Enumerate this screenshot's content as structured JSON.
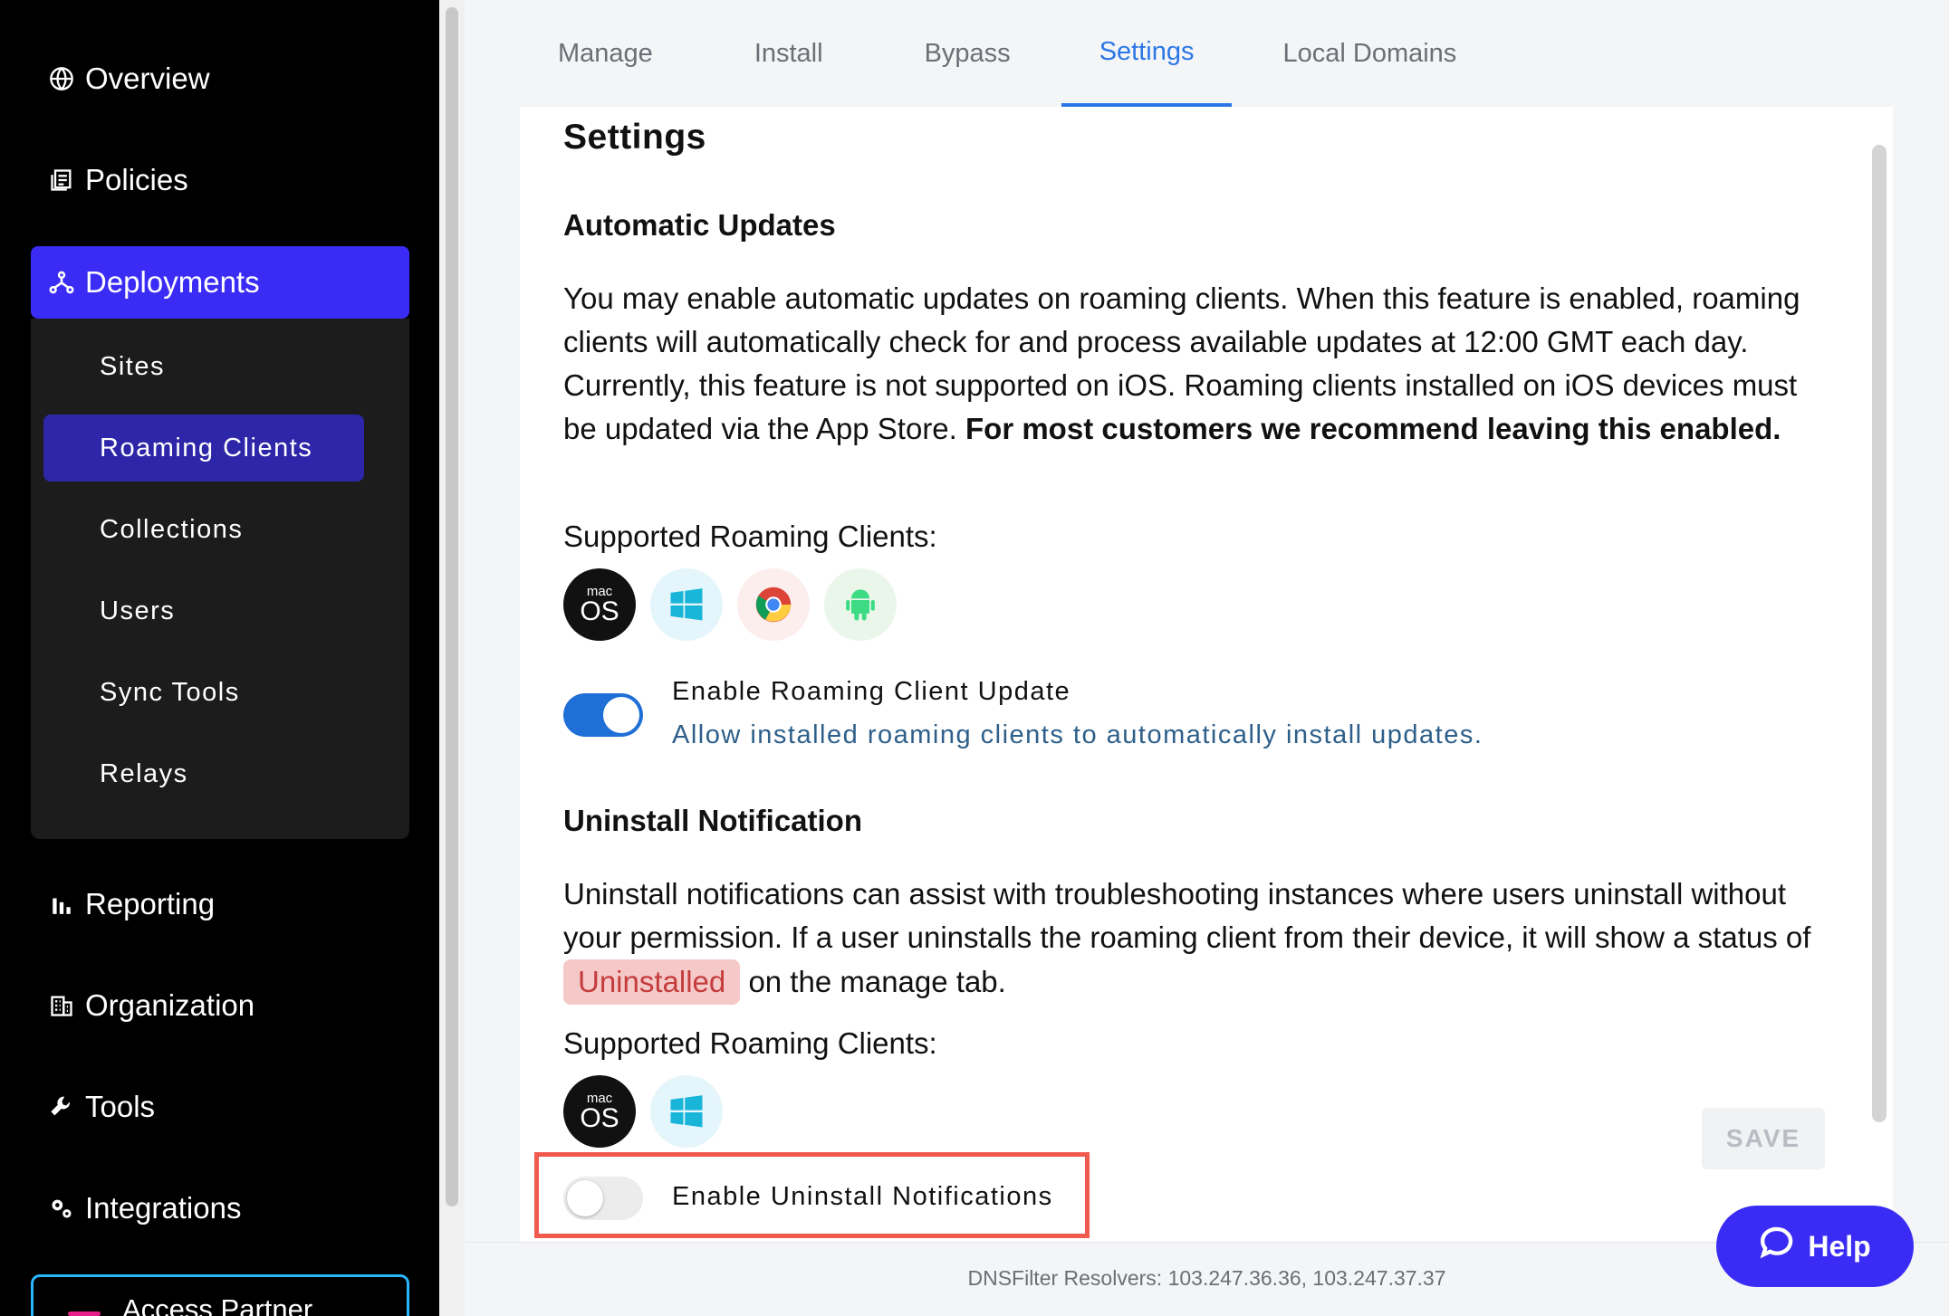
{
  "sidebar": {
    "items": [
      {
        "label": "Overview",
        "icon": "globe-icon"
      },
      {
        "label": "Policies",
        "icon": "document-icon"
      },
      {
        "label": "Deployments",
        "icon": "network-icon"
      },
      {
        "label": "Reporting",
        "icon": "bar-chart-icon"
      },
      {
        "label": "Organization",
        "icon": "building-icon"
      },
      {
        "label": "Tools",
        "icon": "wrench-icon"
      },
      {
        "label": "Integrations",
        "icon": "gears-icon"
      }
    ],
    "sub_items": [
      "Sites",
      "Roaming Clients",
      "Collections",
      "Users",
      "Sync Tools",
      "Relays"
    ],
    "partner_label": "Access Partner"
  },
  "tabs": [
    "Manage",
    "Install",
    "Bypass",
    "Settings",
    "Local Domains"
  ],
  "content": {
    "title": "Settings",
    "auto_updates": {
      "heading": "Automatic Updates",
      "text": "You may enable automatic updates on roaming clients. When this feature is enabled, roaming clients will automatically check for and process available updates at 12:00 GMT each day. Currently, this feature is not supported on iOS. Roaming clients installed on iOS devices must be updated via the App Store.",
      "text_bold": "For most customers we recommend leaving this enabled.",
      "supported_label": "Supported Roaming Clients:",
      "toggle_title": "Enable Roaming Client Update",
      "toggle_desc": "Allow installed roaming clients to automatically install updates."
    },
    "uninstall": {
      "heading": "Uninstall Notification",
      "text_before": "Uninstall notifications can assist with troubleshooting instances where users uninstall without your permission. If a user uninstalls the roaming client from their device, it will show a status of",
      "badge": "Uninstalled",
      "text_after": "on the manage tab.",
      "supported_label": "Supported Roaming Clients:",
      "toggle_title": "Enable Uninstall Notifications"
    },
    "mac_top": "mac",
    "mac_bottom": "OS",
    "save_label": "SAVE"
  },
  "footer": {
    "text": "DNSFilter Resolvers: 103.247.36.36, 103.247.37.37"
  },
  "help": {
    "label": "Help"
  },
  "colors": {
    "accent": "#3a2cf5",
    "tab_active": "#2c77e6",
    "highlight": "#f05a4e"
  }
}
